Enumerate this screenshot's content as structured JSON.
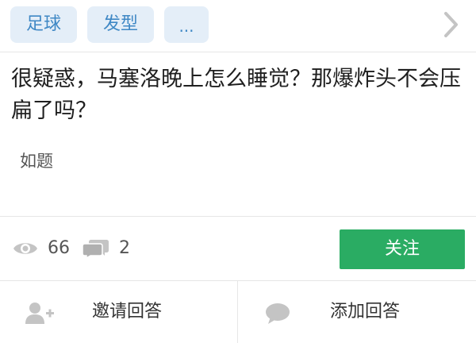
{
  "tags": {
    "items": [
      {
        "label": "足球"
      },
      {
        "label": "发型"
      },
      {
        "label": "..."
      }
    ],
    "more_icon": "chevron-right-icon"
  },
  "question": {
    "title": "很疑惑，马塞洛晚上怎么睡觉？那爆炸头不会压扁了吗？",
    "body": "如题"
  },
  "stats": {
    "views": "66",
    "answers": "2",
    "views_icon": "eye-icon",
    "answers_icon": "comment-icon"
  },
  "follow_button": {
    "label": "关注",
    "color": "#2aac63"
  },
  "actions": {
    "invite": {
      "label": "邀请回答",
      "icon": "invite-user-icon"
    },
    "add_answer": {
      "label": "添加回答",
      "icon": "speech-bubble-icon"
    }
  },
  "colors": {
    "tag_background": "#e4eef8",
    "tag_text": "#3f88c5",
    "icon_gray": "#c4c4c4"
  }
}
